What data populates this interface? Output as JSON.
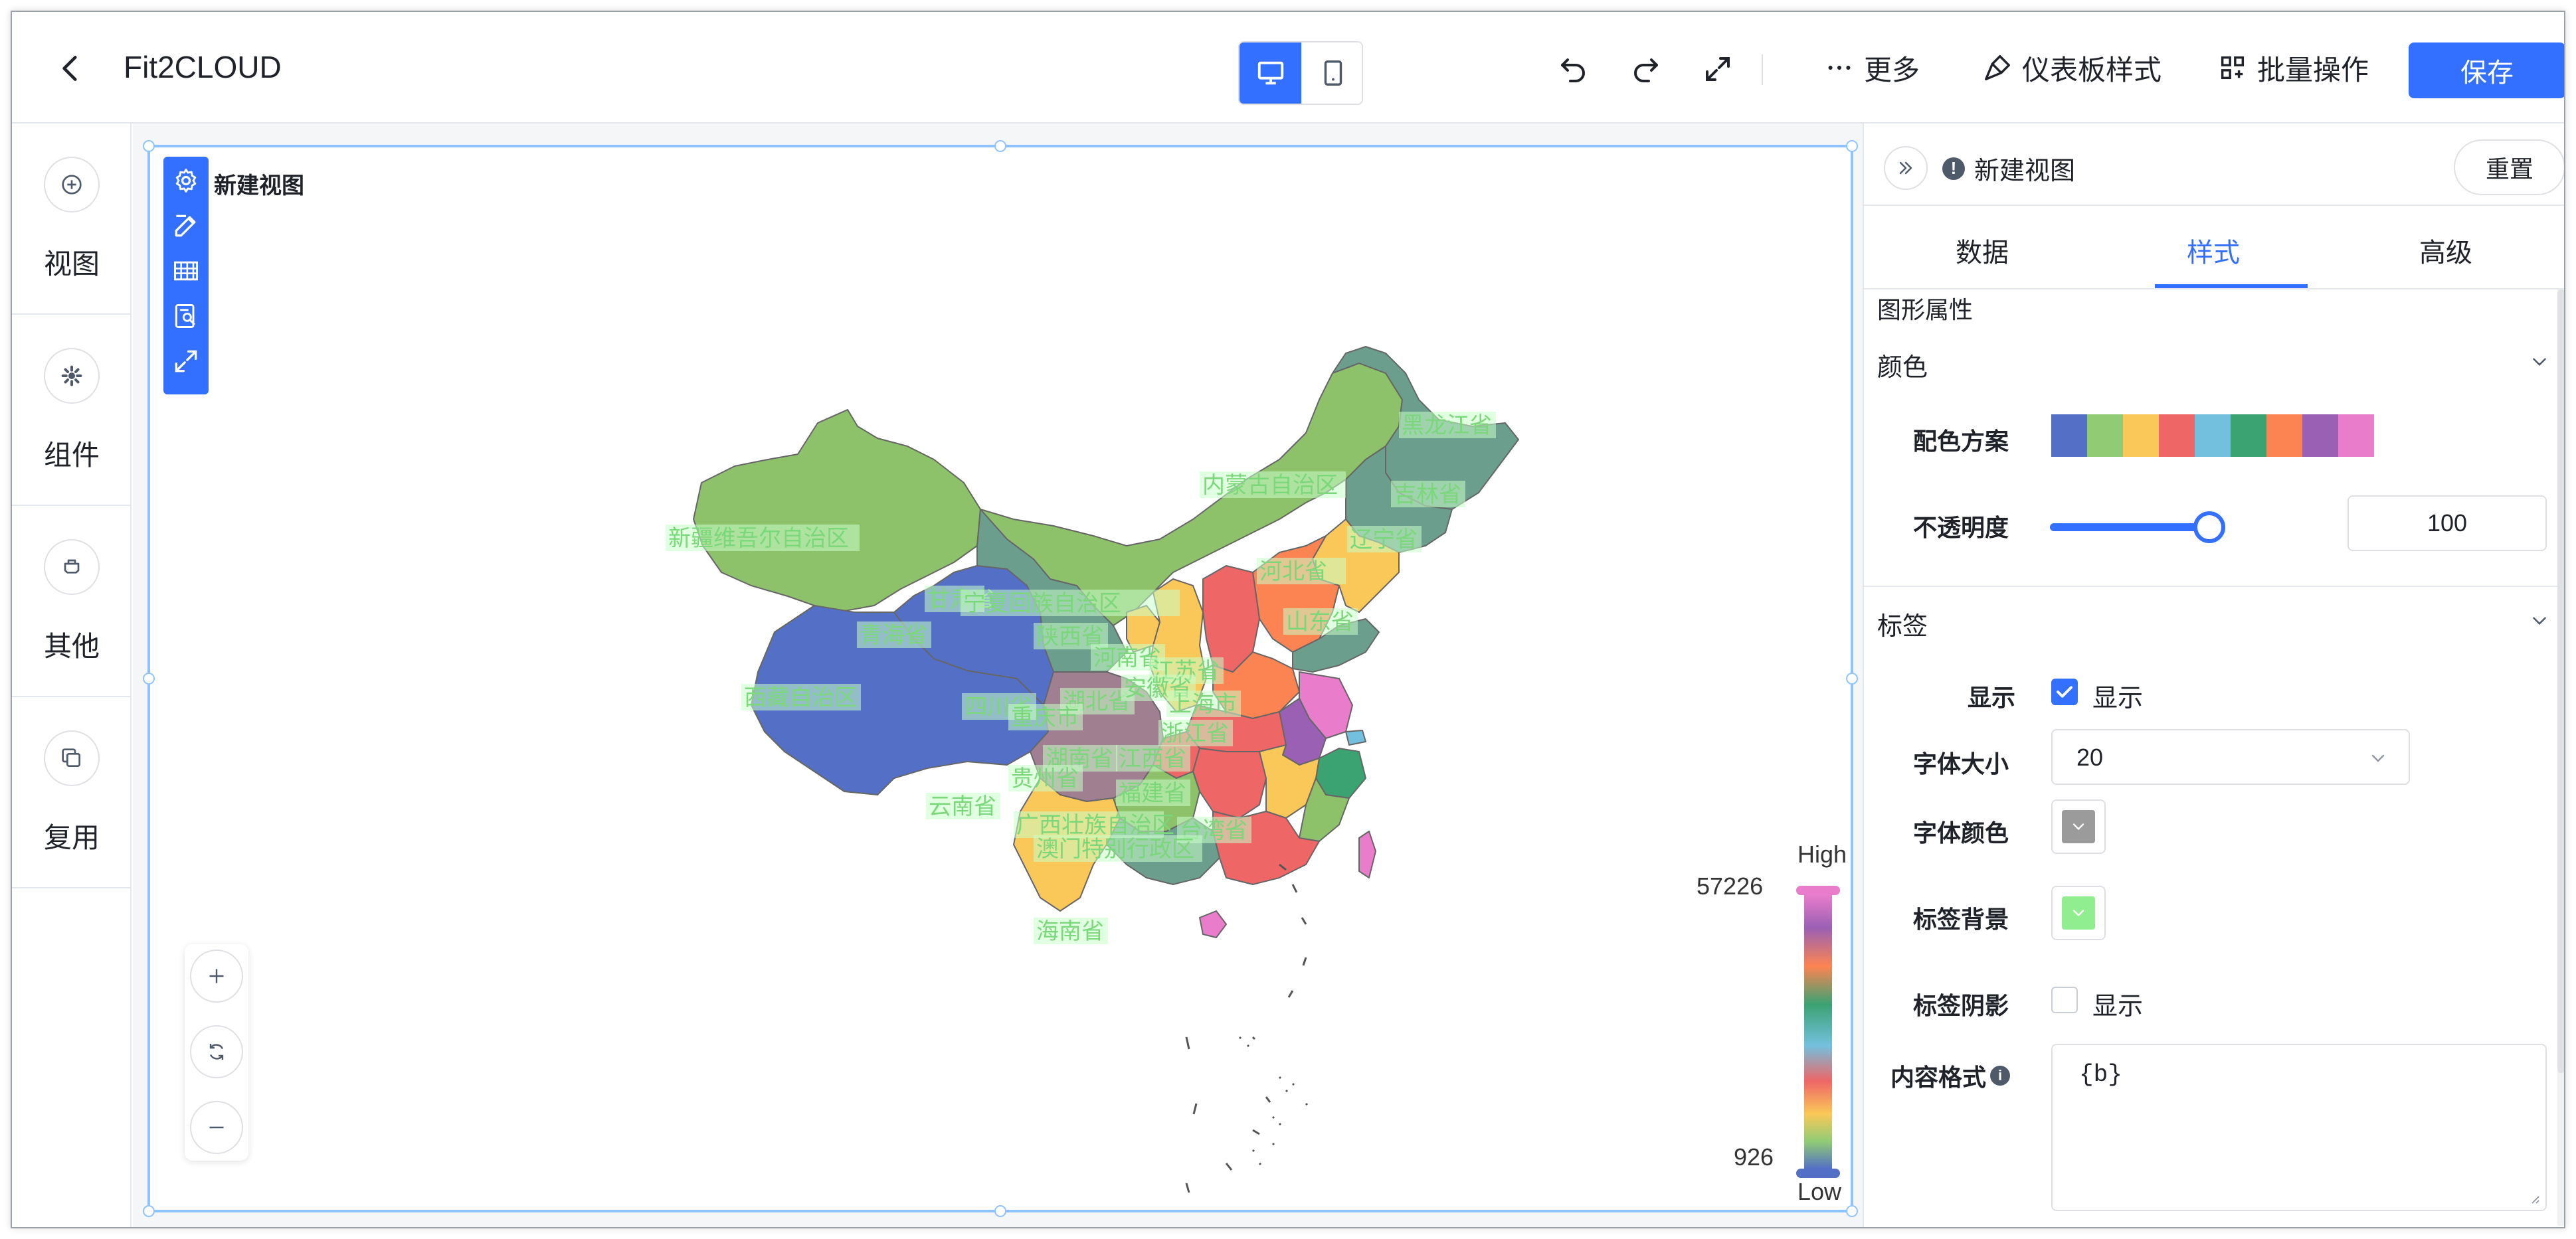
{
  "header": {
    "title": "Fit2CLOUD",
    "more_label": "更多",
    "dashboard_style_label": "仪表板样式",
    "batch_label": "批量操作",
    "save_label": "保存"
  },
  "sidebar": {
    "items": [
      {
        "label": "视图",
        "icon": "plus-circle-icon"
      },
      {
        "label": "组件",
        "icon": "gear-icon"
      },
      {
        "label": "其他",
        "icon": "tag-icon"
      },
      {
        "label": "复用",
        "icon": "copy-icon"
      }
    ]
  },
  "chart": {
    "title": "新建视图",
    "legend_high": "High",
    "legend_low": "Low",
    "legend_max": "57226",
    "legend_min": "926"
  },
  "chart_data": {
    "type": "heatmap",
    "map": "china-provinces",
    "legend": {
      "max": 57226,
      "min": 926,
      "high_label": "High",
      "low_label": "Low"
    },
    "color_scheme": [
      "#5470c6",
      "#91cc75",
      "#fac858",
      "#ee6666",
      "#73c0de",
      "#3ba272",
      "#fc8452",
      "#9a60b4",
      "#ea7ccc"
    ],
    "labels": [
      "黑龙江省",
      "内蒙古自治区",
      "吉林省",
      "辽宁省",
      "新疆维吾尔自治区",
      "河北省",
      "甘肃省",
      "宁夏回族自治区",
      "山东省",
      "青海省",
      "陕西省",
      "河南省",
      "江苏省",
      "西藏自治区",
      "四川省",
      "湖北省",
      "安徽省",
      "上海市",
      "重庆市",
      "浙江省",
      "湖南省",
      "江西省",
      "贵州省",
      "福建省",
      "云南省",
      "广西壮族自治区",
      "台湾省",
      "澳门特别行政区",
      "海南省"
    ]
  },
  "panel": {
    "view_name": "新建视图",
    "reset_label": "重置",
    "tabs": [
      "数据",
      "样式",
      "高级"
    ],
    "active_tab": "样式",
    "section_graph": "图形属性",
    "color": {
      "title": "颜色",
      "scheme_label": "配色方案",
      "opacity_label": "不透明度",
      "opacity_value": "100",
      "opacity_fraction": 1.0
    },
    "label": {
      "title": "标签",
      "show_label": "显示",
      "show_text": "显示",
      "show_checked": true,
      "font_size_label": "字体大小",
      "font_size_value": "20",
      "font_color_label": "字体颜色",
      "font_color": "#9b9b9b",
      "bg_label": "标签背景",
      "bg_color": "#90ee90",
      "shadow_label": "标签阴影",
      "shadow_text": "显示",
      "shadow_checked": false,
      "format_label": "内容格式",
      "format_value": "{b}"
    }
  }
}
